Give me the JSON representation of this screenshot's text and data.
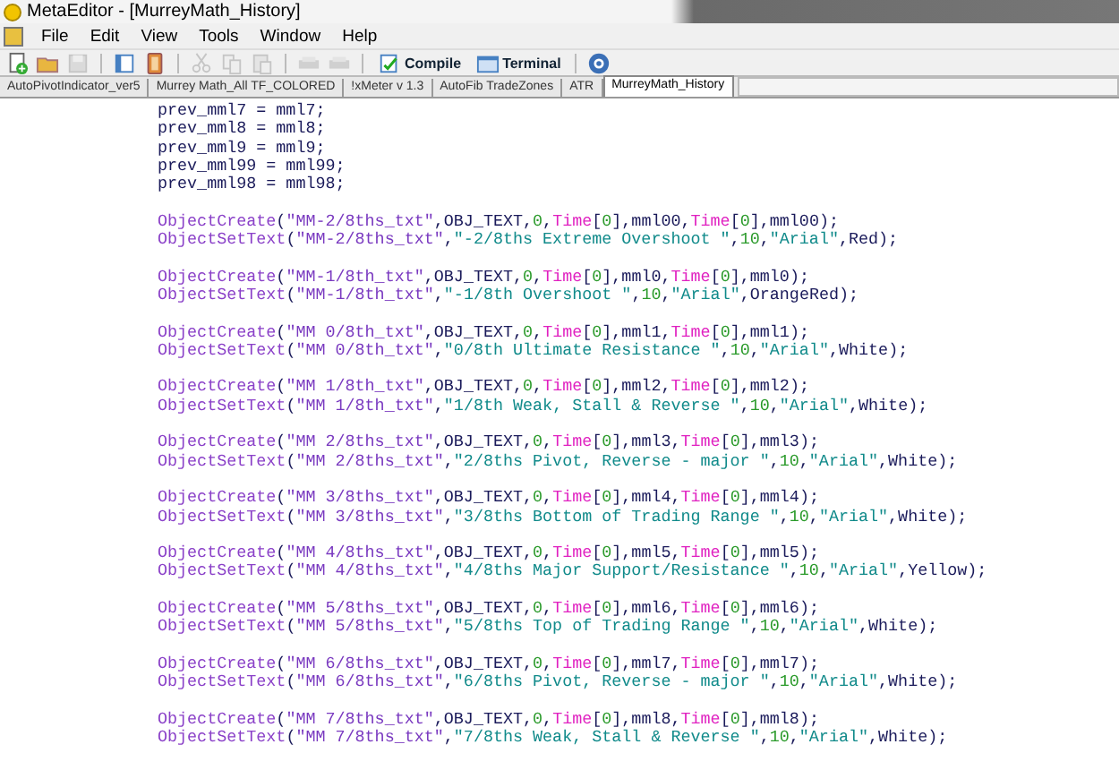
{
  "window": {
    "title": "MetaEditor - [MurreyMath_History]"
  },
  "menu": [
    "File",
    "Edit",
    "View",
    "Tools",
    "Window",
    "Help"
  ],
  "toolbar": [
    {
      "kind": "new"
    },
    {
      "kind": "open"
    },
    {
      "kind": "save",
      "disabled": true
    },
    {
      "kind": "panel"
    },
    {
      "kind": "book"
    },
    {
      "kind": "cut",
      "disabled": true
    },
    {
      "kind": "copy",
      "disabled": true
    },
    {
      "kind": "paste",
      "disabled": true
    },
    {
      "kind": "back",
      "disabled": true
    },
    {
      "kind": "forward",
      "disabled": true
    },
    {
      "kind": "compile",
      "label": "Compile"
    },
    {
      "kind": "terminal",
      "label": "Terminal"
    },
    {
      "kind": "help"
    }
  ],
  "tabs": [
    {
      "label": "AutoPivotIndicator_ver5",
      "selected": false
    },
    {
      "label": "Murrey Math_All TF_COLORED",
      "selected": false
    },
    {
      "label": "!xMeter v 1.3",
      "selected": false
    },
    {
      "label": "AutoFib TradeZones",
      "selected": false
    },
    {
      "label": "ATR",
      "selected": false
    },
    {
      "label": "MurreyMath_History",
      "selected": true
    }
  ],
  "code_blocks": [
    [
      "prev_mml7 = mml7;",
      "prev_mml8 = mml8;",
      "prev_mml9 = mml9;",
      "prev_mml99 = mml99;",
      "prev_mml98 = mml98;"
    ],
    [
      "ObjectCreate(\"MM-2/8ths_txt\",OBJ_TEXT,0,Time[0],mml00,Time[0],mml00);",
      "ObjectSetText(\"MM-2/8ths_txt\",\"-2/8ths Extreme Overshoot \",10,\"Arial\",Red);"
    ],
    [
      "ObjectCreate(\"MM-1/8th_txt\",OBJ_TEXT,0,Time[0],mml0,Time[0],mml0);",
      "ObjectSetText(\"MM-1/8th_txt\",\"-1/8th Overshoot \",10,\"Arial\",OrangeRed);"
    ],
    [
      "ObjectCreate(\"MM 0/8th_txt\",OBJ_TEXT,0,Time[0],mml1,Time[0],mml1);",
      "ObjectSetText(\"MM 0/8th_txt\",\"0/8th Ultimate Resistance \",10,\"Arial\",White);"
    ],
    [
      "ObjectCreate(\"MM 1/8th_txt\",OBJ_TEXT,0,Time[0],mml2,Time[0],mml2);",
      "ObjectSetText(\"MM 1/8th_txt\",\"1/8th Weak, Stall & Reverse \",10,\"Arial\",White);"
    ],
    [
      "ObjectCreate(\"MM 2/8ths_txt\",OBJ_TEXT,0,Time[0],mml3,Time[0],mml3);",
      "ObjectSetText(\"MM 2/8ths_txt\",\"2/8ths Pivot, Reverse - major \",10,\"Arial\",White);"
    ],
    [
      "ObjectCreate(\"MM 3/8ths_txt\",OBJ_TEXT,0,Time[0],mml4,Time[0],mml4);",
      "ObjectSetText(\"MM 3/8ths_txt\",\"3/8ths Bottom of Trading Range \",10,\"Arial\",White);"
    ],
    [
      "ObjectCreate(\"MM 4/8ths_txt\",OBJ_TEXT,0,Time[0],mml5,Time[0],mml5);",
      "ObjectSetText(\"MM 4/8ths_txt\",\"4/8ths Major Support/Resistance \",10,\"Arial\",Yellow);"
    ],
    [
      "ObjectCreate(\"MM 5/8ths_txt\",OBJ_TEXT,0,Time[0],mml6,Time[0],mml6);",
      "ObjectSetText(\"MM 5/8ths_txt\",\"5/8ths Top of Trading Range \",10,\"Arial\",White);"
    ],
    [
      "ObjectCreate(\"MM 6/8ths_txt\",OBJ_TEXT,0,Time[0],mml7,Time[0],mml7);",
      "ObjectSetText(\"MM 6/8ths_txt\",\"6/8ths Pivot, Reverse - major \",10,\"Arial\",White);"
    ],
    [
      "ObjectCreate(\"MM 7/8ths_txt\",OBJ_TEXT,0,Time[0],mml8,Time[0],mml8);",
      "ObjectSetText(\"MM 7/8ths_txt\",\"7/8ths Weak, Stall & Reverse \",10,\"Arial\",White);"
    ]
  ]
}
